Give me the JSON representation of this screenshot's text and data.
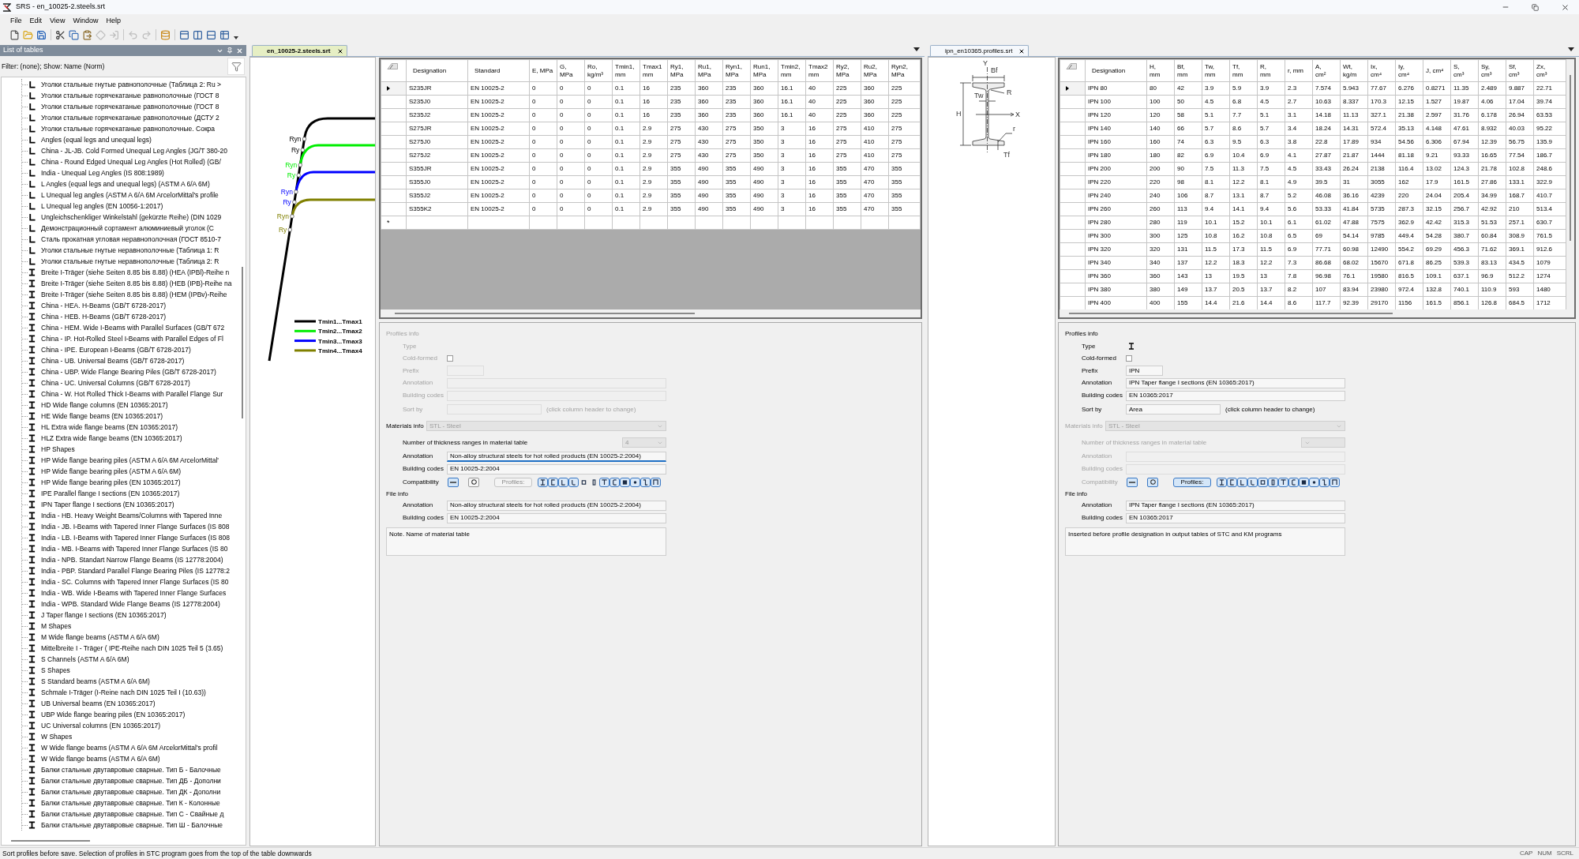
{
  "window": {
    "title": "SRS - en_10025-2.steels.srt"
  },
  "menu": [
    "File",
    "Edit",
    "View",
    "Window",
    "Help"
  ],
  "toolbar": [
    {
      "kind": "new",
      "disabled": false
    },
    {
      "kind": "open",
      "disabled": false
    },
    {
      "kind": "save",
      "disabled": false
    },
    {
      "kind": "separator"
    },
    {
      "kind": "cut",
      "disabled": false
    },
    {
      "kind": "copy",
      "disabled": false
    },
    {
      "kind": "paste",
      "disabled": false
    },
    {
      "kind": "transform",
      "disabled": true
    },
    {
      "kind": "import",
      "disabled": true
    },
    {
      "kind": "separator"
    },
    {
      "kind": "undo",
      "disabled": true
    },
    {
      "kind": "redo",
      "disabled": true
    },
    {
      "kind": "separator"
    },
    {
      "kind": "database",
      "disabled": false
    },
    {
      "kind": "separator"
    },
    {
      "kind": "layout-top",
      "disabled": false
    },
    {
      "kind": "layout-columns",
      "disabled": false
    },
    {
      "kind": "layout-rows",
      "disabled": false
    },
    {
      "kind": "layout-table",
      "disabled": false
    }
  ],
  "sidebar": {
    "title": "List of tables",
    "filter": "Filter: (none); Show: Name (Norm)",
    "items": [
      {
        "kind": "angle",
        "label": "Уголки стальные гнутые равнополочные (Таблица 2: Ru >"
      },
      {
        "kind": "angle",
        "label": "Уголки стальные горячекатаные равнополочные (ГОСТ 8"
      },
      {
        "kind": "angle",
        "label": "Уголки стальные горячекатаные равнополочные (ГОСТ 8"
      },
      {
        "kind": "angle",
        "label": "Уголки стальные горячекатаные равнополочные (ДСТУ 2"
      },
      {
        "kind": "angle",
        "label": "Уголки стальные горячекатаные равнополочные. Сокра"
      },
      {
        "kind": "angle",
        "label": "Angles (equal legs and unequal legs)"
      },
      {
        "kind": "angle",
        "label": "China - JL-JB. Cold Formed Unequal Leg Angles (JG/T 380-20"
      },
      {
        "kind": "angle",
        "label": "China - Round Edged Unequal Leg Angles (Hot Rolled) (GB/"
      },
      {
        "kind": "angle",
        "label": "India - Unequal Leg Angles (IS 808:1989)"
      },
      {
        "kind": "angle",
        "label": "L Angles (equal legs and unequal legs) (ASTM A 6/A 6M)"
      },
      {
        "kind": "angle",
        "label": "L Unequal leg angles (ASTM A 6/A 6M ArcelorMittal's profile"
      },
      {
        "kind": "angle",
        "label": "L Unequal leg angles (EN 10056-1:2017)"
      },
      {
        "kind": "angle",
        "label": "Ungleichschenkliger Winkelstahl (gekürzte Reihe) (DIN 1029"
      },
      {
        "kind": "angle",
        "label": "Демонстрационный сортамент алюминиевый уголок (С"
      },
      {
        "kind": "angle",
        "label": "Сталь прокатная угловая неравнополочная (ГОСТ 8510-7"
      },
      {
        "kind": "angle",
        "label": "Уголки стальные гнутые неравнополочные (Таблица 1: R"
      },
      {
        "kind": "angle",
        "label": "Уголки стальные гнутые неравнополочные (Таблица 2: R"
      },
      {
        "kind": "ibeam",
        "label": "Breite I-Träger (siehe Seiten 8.85 bis 8.88) (HEA (IPBl)-Reihe n"
      },
      {
        "kind": "ibeam",
        "label": "Breite I-Träger (siehe Seiten 8.85 bis 8.88) (HEB (IPB)-Reihe na"
      },
      {
        "kind": "ibeam",
        "label": "Breite I-Träger (siehe Seiten 8.85 bis 8.88) (HEM (IPBv)-Reihe"
      },
      {
        "kind": "ibeam",
        "label": "China - HEA. H-Beams (GB/T 6728-2017)"
      },
      {
        "kind": "ibeam",
        "label": "China - HEB. H-Beams (GB/T 6728-2017)"
      },
      {
        "kind": "ibeam",
        "label": "China - HEM. Wide I-Beams with Parallel Surfaces (GB/T 672"
      },
      {
        "kind": "ibeam",
        "label": "China - IP. Hot-Rolled Steel I-Beams with Parallel Edges of Fl"
      },
      {
        "kind": "ibeam",
        "label": "China - IPE. European I-Beams (GB/T 6728-2017)"
      },
      {
        "kind": "ibeam",
        "label": "China - UB. Universal Beams (GB/T 6728-2017)"
      },
      {
        "kind": "ibeam",
        "label": "China - UBP. Wide Flange Bearing Piles (GB/T 6728-2017)"
      },
      {
        "kind": "ibeam",
        "label": "China - UC. Universal Columns (GB/T 6728-2017)"
      },
      {
        "kind": "ibeam",
        "label": "China - W. Hot Rolled Thick I-Beams with Parallel Flange Sur"
      },
      {
        "kind": "ibeam",
        "label": "HD Wide flange columns (EN 10365:2017)"
      },
      {
        "kind": "ibeam",
        "label": "HE Wide flange beams (EN 10365:2017)"
      },
      {
        "kind": "ibeam",
        "label": "HL Extra wide flange beams (EN 10365:2017)"
      },
      {
        "kind": "ibeam",
        "label": "HLZ Extra wide flange beams (EN 10365:2017)"
      },
      {
        "kind": "ibeam",
        "label": "HP Shapes"
      },
      {
        "kind": "ibeam",
        "label": "HP Wide flange bearing piles (ASTM A 6/A 6M ArcelorMittal'"
      },
      {
        "kind": "ibeam",
        "label": "HP Wide flange bearing piles (ASTM A 6/A 6M)"
      },
      {
        "kind": "ibeam",
        "label": "HP Wide flange bearing piles (EN 10365:2017)"
      },
      {
        "kind": "ibeam",
        "label": "IPE Parallel flange I sections (EN 10365:2017)"
      },
      {
        "kind": "ibeam",
        "label": "IPN Taper flange I sections (EN 10365:2017)"
      },
      {
        "kind": "ibeam",
        "label": "India - HB. Heavy Weight Beams/Columns with Tapered Inne"
      },
      {
        "kind": "ibeam",
        "label": "India - JB. I-Beams with Tapered Inner Flange Surfaces (IS 808"
      },
      {
        "kind": "ibeam",
        "label": "India - LB. I-Beams with Tapered Inner Flange Surfaces (IS 808"
      },
      {
        "kind": "ibeam",
        "label": "India - MB. I-Beams with Tapered Inner Flange Surfaces (IS 80"
      },
      {
        "kind": "ibeam",
        "label": "India - NPB. Standart Narrow Flange Beams (IS 12778:2004)"
      },
      {
        "kind": "ibeam",
        "label": "India - PBP. Standard Parallel Flange Bearing Piles (IS 12778:2"
      },
      {
        "kind": "ibeam",
        "label": "India - SC. Columns with Tapered Inner Flange Surfaces (IS 80"
      },
      {
        "kind": "ibeam",
        "label": "India - WB. Wide I-Beams with Tapered Inner Flange Surfaces"
      },
      {
        "kind": "ibeam",
        "label": "India - WPB. Standard Wide Flange Beams (IS 12778:2004)"
      },
      {
        "kind": "ibeam",
        "label": "J Taper flange I sections (EN 10365:2017)"
      },
      {
        "kind": "ibeam",
        "label": "M Shapes"
      },
      {
        "kind": "ibeam",
        "label": "M Wide flange beams (ASTM A 6/A 6M)"
      },
      {
        "kind": "ibeam",
        "label": "Mittelbreite I - Träger ( IPE-Reihe nach DIN 1025 Teil 5 (3.65)"
      },
      {
        "kind": "ibeam",
        "label": "S Channels (ASTM A 6/A 6M)"
      },
      {
        "kind": "ibeam",
        "label": "S Shapes"
      },
      {
        "kind": "ibeam",
        "label": "S Standard beams (ASTM A 6/A 6M)"
      },
      {
        "kind": "ibeam",
        "label": "Schmale I-Träger (I-Reine nach DIN 1025 Teil I (10.63))"
      },
      {
        "kind": "ibeam",
        "label": "UB Universal beams (EN 10365:2017)"
      },
      {
        "kind": "ibeam",
        "label": "UBP Wide flange bearing piles (EN 10365:2017)"
      },
      {
        "kind": "ibeam",
        "label": "UC Universal columns (EN 10365:2017)"
      },
      {
        "kind": "ibeam",
        "label": "W Shapes"
      },
      {
        "kind": "ibeam",
        "label": "W Wide flange beams (ASTM A 6/A 6M ArcelorMittal's profil"
      },
      {
        "kind": "ibeam",
        "label": "W Wide flange beams (ASTM A 6/A 6M)"
      },
      {
        "kind": "ibeam",
        "label": "Балки стальные двутавровые сварные. Тип Б - Балочные"
      },
      {
        "kind": "ibeam",
        "label": "Балки стальные двутавровые сварные. Тип ДБ - Дополни"
      },
      {
        "kind": "ibeam",
        "label": "Балки стальные двутавровые сварные. Тип ДК - Дополни"
      },
      {
        "kind": "ibeam",
        "label": "Балки стальные двутавровые сварные. Тип К - Колонные"
      },
      {
        "kind": "ibeam",
        "label": "Балки стальные двутавровые сварные. Тип С - Свайные д"
      },
      {
        "kind": "ibeam",
        "label": "Балки стальные двутавровые сварные. Тип Ш - Балочные"
      }
    ]
  },
  "steel_document": {
    "tab": {
      "label": "en_10025-2.steels.srt",
      "active": true
    },
    "diagram": {
      "curves": [
        {
          "color": "#000000",
          "ryn": "Ryn",
          "ry": "Ry",
          "legend": "Tmin1...Tmax1"
        },
        {
          "color": "#00ee00",
          "ryn": "Ryn",
          "ry": "Ry",
          "legend": "Tmin2...Tmax2"
        },
        {
          "color": "#0000ff",
          "ryn": "Ryn",
          "ry": "Ry",
          "legend": "Tmin3...Tmax3"
        },
        {
          "color": "#808000",
          "ryn": "Ryn",
          "ry": "Ry",
          "legend": "Tmin4...Tmax4"
        }
      ]
    },
    "table": {
      "columns": [
        "Designation",
        "Standard",
        "E, MPa",
        "G,\nMPa",
        "Ro,\nkg/m³",
        "Tmin1,\nmm",
        "Tmax1\nmm",
        "Ry1,\nMPa",
        "Ru1,\nMPa",
        "Ryn1,\nMPa",
        "Run1,\nMPa",
        "Tmin2,\nmm",
        "Tmax2\nmm",
        "Ry2,\nMPa",
        "Ru2,\nMPa",
        "Ryn2,\nMPa"
      ],
      "rows": [
        {
          "current": true,
          "cells": [
            "S235JR",
            "EN 10025-2",
            "0",
            "0",
            "0",
            "0.1",
            "16",
            "235",
            "360",
            "235",
            "360",
            "16.1",
            "40",
            "225",
            "360",
            "225"
          ]
        },
        {
          "current": false,
          "cells": [
            "S235J0",
            "EN 10025-2",
            "0",
            "0",
            "0",
            "0.1",
            "16",
            "235",
            "360",
            "235",
            "360",
            "16.1",
            "40",
            "225",
            "360",
            "225"
          ]
        },
        {
          "current": false,
          "cells": [
            "S235J2",
            "EN 10025-2",
            "0",
            "0",
            "0",
            "0.1",
            "16",
            "235",
            "360",
            "235",
            "360",
            "16.1",
            "40",
            "225",
            "360",
            "225"
          ]
        },
        {
          "current": false,
          "cells": [
            "S275JR",
            "EN 10025-2",
            "0",
            "0",
            "0",
            "0.1",
            "2.9",
            "275",
            "430",
            "275",
            "350",
            "3",
            "16",
            "275",
            "410",
            "275"
          ]
        },
        {
          "current": false,
          "cells": [
            "S275J0",
            "EN 10025-2",
            "0",
            "0",
            "0",
            "0.1",
            "2.9",
            "275",
            "430",
            "275",
            "350",
            "3",
            "16",
            "275",
            "410",
            "275"
          ]
        },
        {
          "current": false,
          "cells": [
            "S275J2",
            "EN 10025-2",
            "0",
            "0",
            "0",
            "0.1",
            "2.9",
            "275",
            "430",
            "275",
            "350",
            "3",
            "16",
            "275",
            "410",
            "275"
          ]
        },
        {
          "current": false,
          "cells": [
            "S355JR",
            "EN 10025-2",
            "0",
            "0",
            "0",
            "0.1",
            "2.9",
            "355",
            "490",
            "355",
            "490",
            "3",
            "16",
            "355",
            "470",
            "355"
          ]
        },
        {
          "current": false,
          "cells": [
            "S355J0",
            "EN 10025-2",
            "0",
            "0",
            "0",
            "0.1",
            "2.9",
            "355",
            "490",
            "355",
            "490",
            "3",
            "16",
            "355",
            "470",
            "355"
          ]
        },
        {
          "current": false,
          "cells": [
            "S355J2",
            "EN 10025-2",
            "0",
            "0",
            "0",
            "0.1",
            "2.9",
            "355",
            "490",
            "355",
            "490",
            "3",
            "16",
            "355",
            "470",
            "355"
          ]
        },
        {
          "current": false,
          "cells": [
            "S355K2",
            "EN 10025-2",
            "0",
            "0",
            "0",
            "0.1",
            "2.9",
            "355",
            "490",
            "355",
            "490",
            "3",
            "16",
            "355",
            "470",
            "355"
          ]
        }
      ],
      "new_row_marker": "*"
    },
    "properties": {
      "profiles_info": {
        "title": "Profiles info",
        "disabled": true,
        "rows": [
          {
            "kind": "type",
            "label": "Type"
          },
          {
            "kind": "checkbox",
            "label": "Cold-formed",
            "checked": false
          },
          {
            "kind": "short-field",
            "label": "Prefix"
          },
          {
            "kind": "field",
            "label": "Annotation",
            "focused": false
          },
          {
            "kind": "field",
            "label": "Building codes",
            "focused": false
          },
          {
            "kind": "sort-field",
            "label": "Sort by",
            "hint": "(click column header to change)"
          }
        ]
      },
      "materials_info": {
        "title": "Materials info",
        "disabled": false,
        "select": {
          "value": "STL - Steel",
          "disabled": true
        },
        "rows": [
          {
            "kind": "select",
            "label": "Number of thickness ranges in material table",
            "value": "4",
            "disabled": true
          },
          {
            "kind": "field",
            "label": "Annotation",
            "value": "Non-alloy structural steels for hot rolled products (EN 10025-2:2004)",
            "focused": true
          },
          {
            "kind": "field",
            "label": "Building codes",
            "value": "EN 10025-2:2004",
            "focused": false
          },
          {
            "kind": "compatibility",
            "label": "Compatibility",
            "toggles": [
              {
                "kind": "line",
                "on": true
              },
              {
                "kind": "circle",
                "on": false
              }
            ],
            "profiles_button": {
              "label": "Profiles:",
              "on": false
            },
            "profiles": [
              {
                "kind": "ibeam",
                "on": true
              },
              {
                "kind": "channel",
                "on": true
              },
              {
                "kind": "angle",
                "on": true
              },
              {
                "kind": "bent-angle",
                "on": true
              },
              {
                "kind": "square-tube",
                "on": false
              },
              {
                "kind": "rect-tube",
                "on": false
              },
              {
                "kind": "tee",
                "on": true
              },
              {
                "kind": "bent-channel",
                "on": true
              },
              {
                "kind": "bar",
                "on": true
              },
              {
                "kind": "rod",
                "on": true
              },
              {
                "kind": "zee",
                "on": true
              },
              {
                "kind": "hat",
                "on": true
              }
            ]
          }
        ]
      },
      "file_info": {
        "title": "File info",
        "disabled": false,
        "rows": [
          {
            "kind": "field",
            "label": "Annotation",
            "value": "Non-alloy structural steels for hot rolled products (EN 10025-2:2004)",
            "focused": false
          },
          {
            "kind": "field",
            "label": "Building codes",
            "value": "EN 10025-2:2004",
            "focused": false
          }
        ]
      },
      "note": "Note. Name of material table"
    }
  },
  "profile_document": {
    "tab": {
      "label": "ipn_en10365.profiles.srt",
      "active": false
    },
    "section_drawing": {
      "labels": [
        "Y",
        "Bf",
        "R",
        "Tw",
        "H",
        "X",
        "r",
        "Tf"
      ]
    },
    "table": {
      "columns": [
        "Designation",
        "H,\nmm",
        "Bf,\nmm",
        "Tw,\nmm",
        "Tf,\nmm",
        "R,\nmm",
        "r, mm",
        "A,\ncm²",
        "Wt,\nkg/m",
        "Ix,\ncm⁴",
        "Iy,\ncm⁴",
        "J, cm⁴",
        "S,\ncm³",
        "Sy,\ncm³",
        "Sf,\ncm³",
        "Zx,\ncm³"
      ],
      "rows": [
        {
          "current": true,
          "cells": [
            "IPN 80",
            "80",
            "42",
            "3.9",
            "5.9",
            "3.9",
            "2.3",
            "7.574",
            "5.943",
            "77.67",
            "6.276",
            "0.8271",
            "11.35",
            "2.489",
            "9.887",
            "22.71"
          ]
        },
        {
          "current": false,
          "cells": [
            "IPN 100",
            "100",
            "50",
            "4.5",
            "6.8",
            "4.5",
            "2.7",
            "10.63",
            "8.337",
            "170.3",
            "12.15",
            "1.527",
            "19.87",
            "4.06",
            "17.04",
            "39.74"
          ]
        },
        {
          "current": false,
          "cells": [
            "IPN 120",
            "120",
            "58",
            "5.1",
            "7.7",
            "5.1",
            "3.1",
            "14.18",
            "11.13",
            "327.1",
            "21.38",
            "2.597",
            "31.76",
            "6.178",
            "26.94",
            "63.53"
          ]
        },
        {
          "current": false,
          "cells": [
            "IPN 140",
            "140",
            "66",
            "5.7",
            "8.6",
            "5.7",
            "3.4",
            "18.24",
            "14.31",
            "572.4",
            "35.13",
            "4.148",
            "47.61",
            "8.932",
            "40.03",
            "95.22"
          ]
        },
        {
          "current": false,
          "cells": [
            "IPN 160",
            "160",
            "74",
            "6.3",
            "9.5",
            "6.3",
            "3.8",
            "22.8",
            "17.89",
            "934",
            "54.56",
            "6.306",
            "67.94",
            "12.39",
            "56.75",
            "135.9"
          ]
        },
        {
          "current": false,
          "cells": [
            "IPN 180",
            "180",
            "82",
            "6.9",
            "10.4",
            "6.9",
            "4.1",
            "27.87",
            "21.87",
            "1444",
            "81.18",
            "9.21",
            "93.33",
            "16.65",
            "77.54",
            "186.7"
          ]
        },
        {
          "current": false,
          "cells": [
            "IPN 200",
            "200",
            "90",
            "7.5",
            "11.3",
            "7.5",
            "4.5",
            "33.43",
            "26.24",
            "2138",
            "116.4",
            "13.02",
            "124.3",
            "21.78",
            "102.8",
            "248.6"
          ]
        },
        {
          "current": false,
          "cells": [
            "IPN 220",
            "220",
            "98",
            "8.1",
            "12.2",
            "8.1",
            "4.9",
            "39.5",
            "31",
            "3055",
            "162",
            "17.9",
            "161.5",
            "27.86",
            "133.1",
            "322.9"
          ]
        },
        {
          "current": false,
          "cells": [
            "IPN 240",
            "240",
            "106",
            "8.7",
            "13.1",
            "8.7",
            "5.2",
            "46.08",
            "36.16",
            "4239",
            "220",
            "24.04",
            "205.4",
            "34.99",
            "168.7",
            "410.7"
          ]
        },
        {
          "current": false,
          "cells": [
            "IPN 260",
            "260",
            "113",
            "9.4",
            "14.1",
            "9.4",
            "5.6",
            "53.33",
            "41.84",
            "5735",
            "287.3",
            "32.15",
            "256.7",
            "42.92",
            "210",
            "513.4"
          ]
        },
        {
          "current": false,
          "cells": [
            "IPN 280",
            "280",
            "119",
            "10.1",
            "15.2",
            "10.1",
            "6.1",
            "61.02",
            "47.88",
            "7575",
            "362.9",
            "42.42",
            "315.3",
            "51.53",
            "257.1",
            "630.7"
          ]
        },
        {
          "current": false,
          "cells": [
            "IPN 300",
            "300",
            "125",
            "10.8",
            "16.2",
            "10.8",
            "6.5",
            "69",
            "54.14",
            "9785",
            "449.4",
            "54.28",
            "380.7",
            "60.84",
            "308.9",
            "761.5"
          ]
        },
        {
          "current": false,
          "cells": [
            "IPN 320",
            "320",
            "131",
            "11.5",
            "17.3",
            "11.5",
            "6.9",
            "77.71",
            "60.98",
            "12490",
            "554.2",
            "69.29",
            "456.3",
            "71.62",
            "369.1",
            "912.6"
          ]
        },
        {
          "current": false,
          "cells": [
            "IPN 340",
            "340",
            "137",
            "12.2",
            "18.3",
            "12.2",
            "7.3",
            "86.68",
            "68.02",
            "15670",
            "671.8",
            "86.25",
            "539.3",
            "83.13",
            "434.5",
            "1079"
          ]
        },
        {
          "current": false,
          "cells": [
            "IPN 360",
            "360",
            "143",
            "13",
            "19.5",
            "13",
            "7.8",
            "96.98",
            "76.1",
            "19580",
            "816.5",
            "109.1",
            "637.1",
            "96.9",
            "512.2",
            "1274"
          ]
        },
        {
          "current": false,
          "cells": [
            "IPN 380",
            "380",
            "149",
            "13.7",
            "20.5",
            "13.7",
            "8.2",
            "107",
            "83.94",
            "23980",
            "972.4",
            "132.8",
            "740.1",
            "110.9",
            "593",
            "1480"
          ]
        },
        {
          "current": false,
          "cells": [
            "IPN 400",
            "400",
            "155",
            "14.4",
            "21.6",
            "14.4",
            "8.6",
            "117.7",
            "92.39",
            "29170",
            "1156",
            "161.5",
            "856.1",
            "126.8",
            "684.5",
            "1712"
          ]
        }
      ]
    },
    "properties": {
      "profiles_info": {
        "title": "Profiles info",
        "disabled": false,
        "rows": [
          {
            "kind": "type",
            "label": "Type",
            "profile": {
              "kind": "ibeam"
            }
          },
          {
            "kind": "checkbox",
            "label": "Cold-formed",
            "checked": false
          },
          {
            "kind": "short-field",
            "label": "Prefix",
            "value": "IPN"
          },
          {
            "kind": "field",
            "label": "Annotation",
            "value": "IPN Taper flange I sections (EN 10365:2017)",
            "focused": false
          },
          {
            "kind": "field",
            "label": "Building codes",
            "value": "EN 10365:2017",
            "focused": false
          },
          {
            "kind": "sort-field",
            "label": "Sort by",
            "value": "Area",
            "hint": "(click column header to change)"
          }
        ]
      },
      "materials_info": {
        "title": "Materials info",
        "disabled": true,
        "select": {
          "value": "STL - Steel",
          "disabled": true
        },
        "rows": [
          {
            "kind": "select",
            "label": "Number of thickness ranges in material table",
            "disabled": true
          },
          {
            "kind": "field",
            "label": "Annotation",
            "focused": false
          },
          {
            "kind": "field",
            "label": "Building codes",
            "focused": false
          },
          {
            "kind": "compatibility",
            "label": "Compatibility",
            "toggles": [
              {
                "kind": "line",
                "on": true
              },
              {
                "kind": "circle",
                "on": true
              }
            ],
            "profiles_button": {
              "label": "Profiles:",
              "on": true
            },
            "profiles": [
              {
                "kind": "ibeam",
                "on": true
              },
              {
                "kind": "channel",
                "on": true
              },
              {
                "kind": "angle",
                "on": true
              },
              {
                "kind": "bent-angle",
                "on": true
              },
              {
                "kind": "square-tube",
                "on": true
              },
              {
                "kind": "rect-tube",
                "on": true
              },
              {
                "kind": "tee",
                "on": true
              },
              {
                "kind": "bent-channel",
                "on": true
              },
              {
                "kind": "bar",
                "on": true
              },
              {
                "kind": "rod",
                "on": true
              },
              {
                "kind": "zee",
                "on": true
              },
              {
                "kind": "hat",
                "on": true
              }
            ]
          }
        ]
      },
      "file_info": {
        "title": "File info",
        "disabled": false,
        "rows": [
          {
            "kind": "field",
            "label": "Annotation",
            "value": "IPN Taper flange I sections (EN 10365:2017)",
            "focused": false
          },
          {
            "kind": "field",
            "label": "Building codes",
            "value": "EN 10365:2017",
            "focused": false
          }
        ]
      },
      "note": "Inserted before profile designation in output tables of STC and KM programs"
    }
  },
  "status_bar": {
    "message": "Sort profiles before save. Selection of profiles in STC program goes from the top of the table downwards",
    "indicators": [
      "CAP",
      "NUM",
      "SCRL"
    ]
  }
}
